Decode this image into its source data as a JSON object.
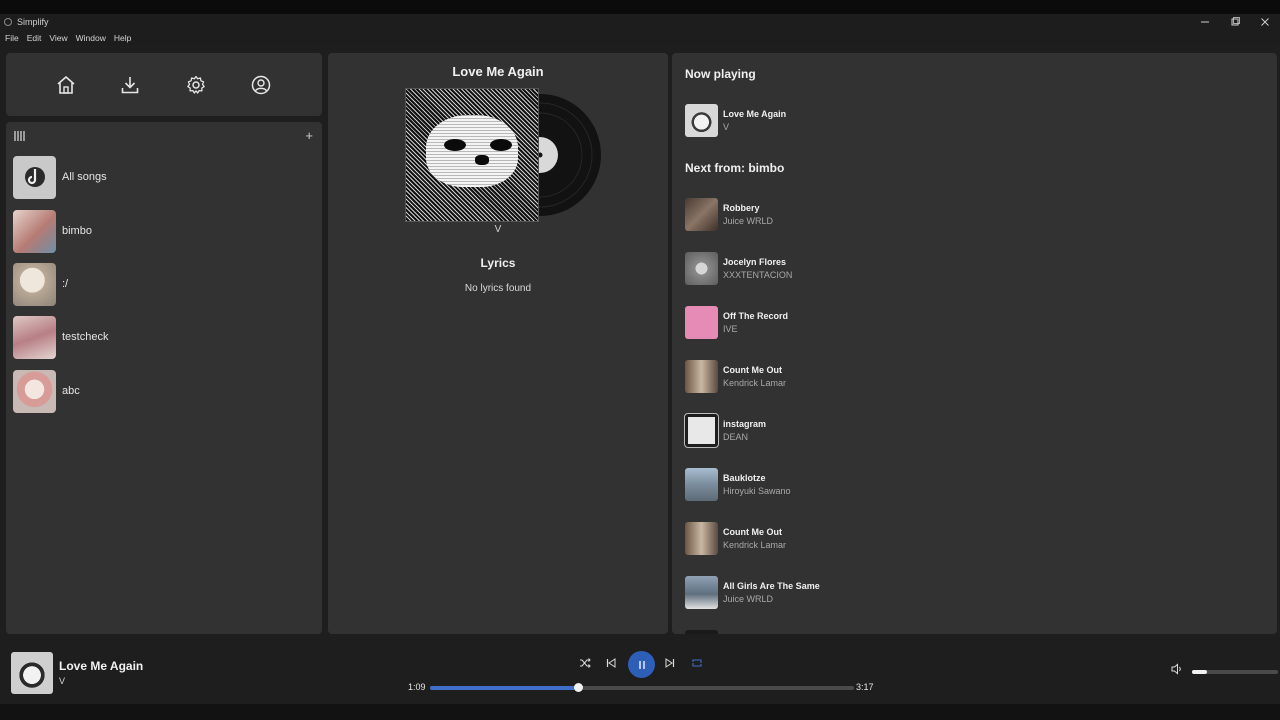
{
  "window": {
    "title": "Simplify"
  },
  "menu": [
    "File",
    "Edit",
    "View",
    "Window",
    "Help"
  ],
  "nav": [
    "home-icon",
    "download-icon",
    "gear-icon",
    "account-icon"
  ],
  "library": {
    "icon": "library-icon",
    "add_label": "+",
    "playlists": [
      {
        "name": "All songs",
        "color": "#c9c9c9"
      },
      {
        "name": "bimbo",
        "color": "#c79b92"
      },
      {
        "name": ":/",
        "color": "#c3b8ae"
      },
      {
        "name": "testcheck",
        "color": "#c7a3a6"
      },
      {
        "name": "abc",
        "color": "#d6b6b0"
      }
    ]
  },
  "current": {
    "title": "Love Me Again",
    "artist": "V",
    "lyrics_heading": "Lyrics",
    "lyrics_text": "No lyrics found"
  },
  "queue": {
    "now_playing_heading": "Now playing",
    "now_playing": {
      "title": "Love Me Again",
      "artist": "V",
      "color": "#8d8d8d"
    },
    "next_heading": "Next from: bimbo",
    "items": [
      {
        "title": "Robbery",
        "artist": "Juice WRLD",
        "color": "#6b5a52"
      },
      {
        "title": "Jocelyn Flores",
        "artist": "XXXTENTACION",
        "color": "#9a9a9a"
      },
      {
        "title": "Off The Record",
        "artist": "IVE",
        "color": "#e58bb6"
      },
      {
        "title": "Count Me Out",
        "artist": "Kendrick Lamar",
        "color": "#8a6f5c"
      },
      {
        "title": "instagram",
        "artist": "DEAN",
        "color": "#d8d8d8"
      },
      {
        "title": "Bauklotze",
        "artist": "Hiroyuki Sawano",
        "color": "#8ea3b8"
      },
      {
        "title": "Count Me Out",
        "artist": "Kendrick Lamar",
        "color": "#8a6f5c"
      },
      {
        "title": "All Girls Are The Same",
        "artist": "Juice WRLD",
        "color": "#7d8fa0"
      }
    ]
  },
  "player": {
    "title": "Love Me Again",
    "artist": "V",
    "elapsed": "1:09",
    "duration": "3:17",
    "progress": 0.35,
    "volume": 0.18,
    "accent": "#3f6fc8",
    "controls": [
      "shuffle-icon",
      "previous-icon",
      "pause-icon",
      "next-icon",
      "repeat-icon"
    ]
  }
}
